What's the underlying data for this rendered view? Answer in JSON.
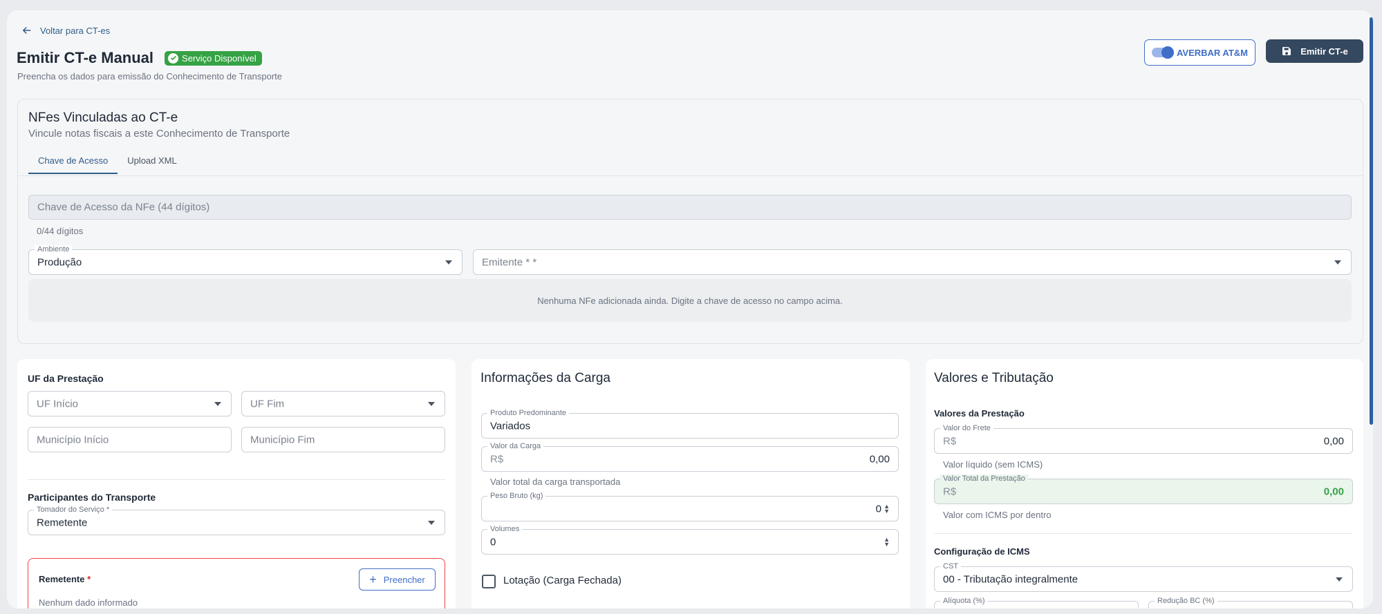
{
  "back_link": "Voltar para CT-es",
  "title": "Emitir CT-e Manual",
  "status_badge": "Serviço Disponível",
  "subtitle": "Preencha os dados para emissão do Conhecimento de Transporte",
  "actions": {
    "averbar_label": "AVERBAR AT&M",
    "averbar_enabled": true,
    "emitir_label": "Emitir CT-e"
  },
  "nfe": {
    "title": "NFes Vinculadas ao CT-e",
    "subtitle": "Vincule notas fiscais a este Conhecimento de Transporte",
    "tabs": [
      "Chave de Acesso",
      "Upload XML"
    ],
    "active_tab": "Chave de Acesso",
    "chave_placeholder": "Chave de Acesso da NFe (44 dígitos)",
    "counter": "0/44 dígitos",
    "ambiente_label": "Ambiente",
    "ambiente_value": "Produção",
    "emitente_placeholder": "Emitente * *",
    "empty_message": "Nenhuma NFe adicionada ainda. Digite a chave de acesso no campo acima."
  },
  "uf": {
    "title": "UF da Prestação",
    "uf_inicio": "UF Início",
    "uf_fim": "UF Fim",
    "municipio_inicio": "Município Início",
    "municipio_fim": "Município Fim"
  },
  "participantes": {
    "title": "Participantes do Transporte",
    "tomador_label": "Tomador do Serviço *",
    "tomador_value": "Remetente",
    "remetente_label": "Remetente",
    "remetente_required": "*",
    "preencher_label": "Preencher",
    "remetente_empty": "Nenhum dado informado"
  },
  "carga": {
    "title": "Informações da Carga",
    "produto_label": "Produto Predominante",
    "produto_value": "Variados",
    "valor_label": "Valor da Carga",
    "valor_prefix": "R$",
    "valor_value": "0,00",
    "valor_helper": "Valor total da carga transportada",
    "peso_label": "Peso Bruto (kg)",
    "peso_value": "0",
    "volumes_label": "Volumes",
    "volumes_value": "0",
    "lotacao_label": "Lotação (Carga Fechada)",
    "lotacao_checked": false
  },
  "valores": {
    "title": "Valores e Tributação",
    "prestacao_title": "Valores da Prestação",
    "frete_label": "Valor do Frete",
    "frete_prefix": "R$",
    "frete_value": "0,00",
    "frete_helper": "Valor líquido (sem ICMS)",
    "total_label": "Valor Total da Prestação",
    "total_prefix": "R$",
    "total_value": "0,00",
    "total_helper": "Valor com ICMS por dentro",
    "icms_title": "Configuração de ICMS",
    "cst_label": "CST",
    "cst_value": "00 - Tributação integralmente",
    "aliquota_label": "Alíquota (%)",
    "reducao_label": "Redução BC (%)"
  },
  "colors": {
    "accent": "#2f5d8a",
    "primary_button": "#34485f",
    "success": "#35a244",
    "error": "#ef4444"
  }
}
